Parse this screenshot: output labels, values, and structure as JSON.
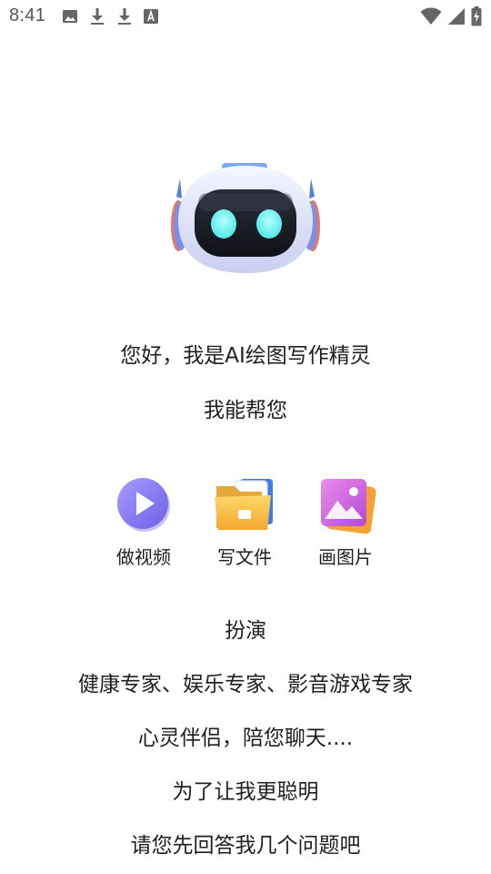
{
  "status_bar": {
    "time": "8:41",
    "left_icons": [
      "image-icon",
      "download-icon",
      "download-icon",
      "font-a-icon"
    ],
    "right_icons": [
      "wifi-icon",
      "signal-icon",
      "battery-charging-icon"
    ]
  },
  "greeting": "您好，我是AI绘图写作精灵",
  "can_help": "我能帮您",
  "features": [
    {
      "label": "做视频",
      "icon": "play-video-icon"
    },
    {
      "label": "写文件",
      "icon": "folder-icon"
    },
    {
      "label": "画图片",
      "icon": "picture-icon"
    }
  ],
  "roleplay_title": "扮演",
  "roleplay_roles": "健康专家、娱乐专家、影音游戏专家",
  "companion": "心灵伴侣，陪您聊天....",
  "smarter": "为了让我更聪明",
  "questions_prompt": "请您先回答我几个问题吧",
  "colors": {
    "text": "#1f1f1f",
    "play_purple": "#8b7cf3",
    "folder_yellow": "#f7c74c",
    "picture_pink": "#e06ad9",
    "robot_eye": "#6ff3f0"
  }
}
